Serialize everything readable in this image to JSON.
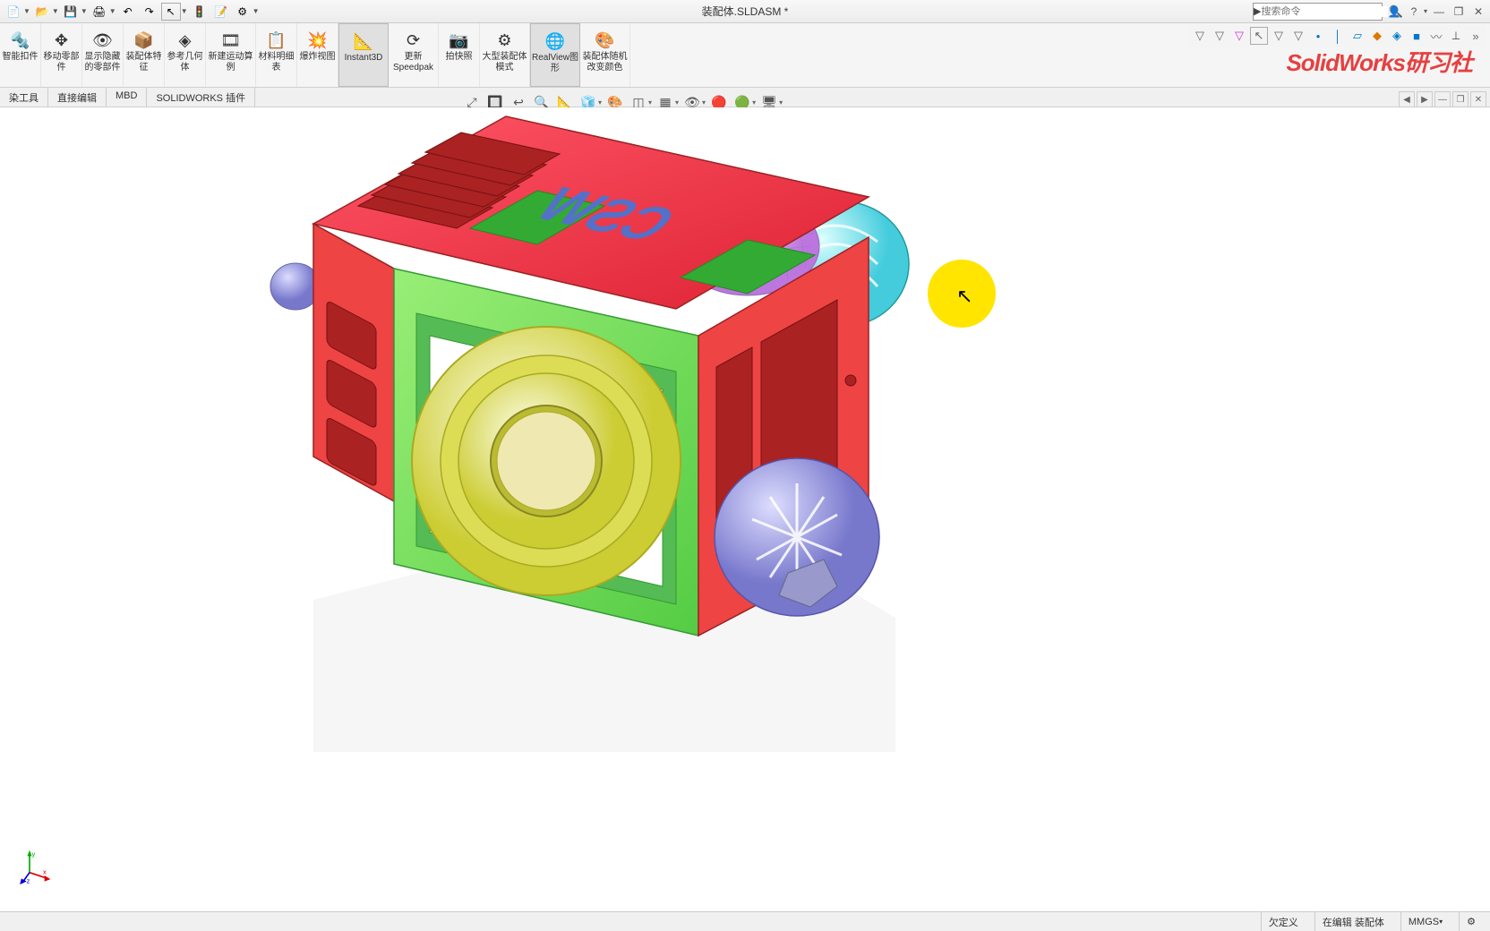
{
  "title": "装配体.SLDASM *",
  "search": {
    "placeholder": "搜索命令"
  },
  "watermark": "SolidWorks研习社",
  "ribbon": [
    {
      "id": "smartfastener",
      "label": "智能扣件",
      "icon": "🔩"
    },
    {
      "id": "movecomp",
      "label": "移动零部件",
      "icon": "✥"
    },
    {
      "id": "showhidden",
      "label": "显示隐藏的零部件",
      "icon": "👁"
    },
    {
      "id": "asmfeat",
      "label": "装配体特征",
      "icon": "📦"
    },
    {
      "id": "refgeom",
      "label": "参考几何体",
      "icon": "◈"
    },
    {
      "id": "newmotion",
      "label": "新建运动算例",
      "icon": "🎞"
    },
    {
      "id": "bom",
      "label": "材料明细表",
      "icon": "📋"
    },
    {
      "id": "exploded",
      "label": "爆炸视图",
      "icon": "💥"
    },
    {
      "id": "instant3d",
      "label": "Instant3D",
      "icon": "📐"
    },
    {
      "id": "speedpak",
      "label": "更新Speedpak",
      "icon": "⟳"
    },
    {
      "id": "snapshot",
      "label": "拍快照",
      "icon": "📷"
    },
    {
      "id": "largeasm",
      "label": "大型装配体模式",
      "icon": "⚙"
    },
    {
      "id": "realview",
      "label": "RealView图形",
      "icon": "🌐"
    },
    {
      "id": "randomcolor",
      "label": "装配体随机改变颜色",
      "icon": "🎨"
    }
  ],
  "tabs": [
    {
      "id": "rendertools",
      "label": "染工具"
    },
    {
      "id": "directedit",
      "label": "直接编辑"
    },
    {
      "id": "mbd",
      "label": "MBD"
    },
    {
      "id": "plugins",
      "label": "SOLIDWORKS 插件"
    }
  ],
  "model_text": "CSW",
  "status": {
    "underdefined": "欠定义",
    "editing": "在编辑 装配体",
    "units": "MMGS"
  },
  "triad": {
    "x": "x",
    "y": "y",
    "z": "z"
  }
}
